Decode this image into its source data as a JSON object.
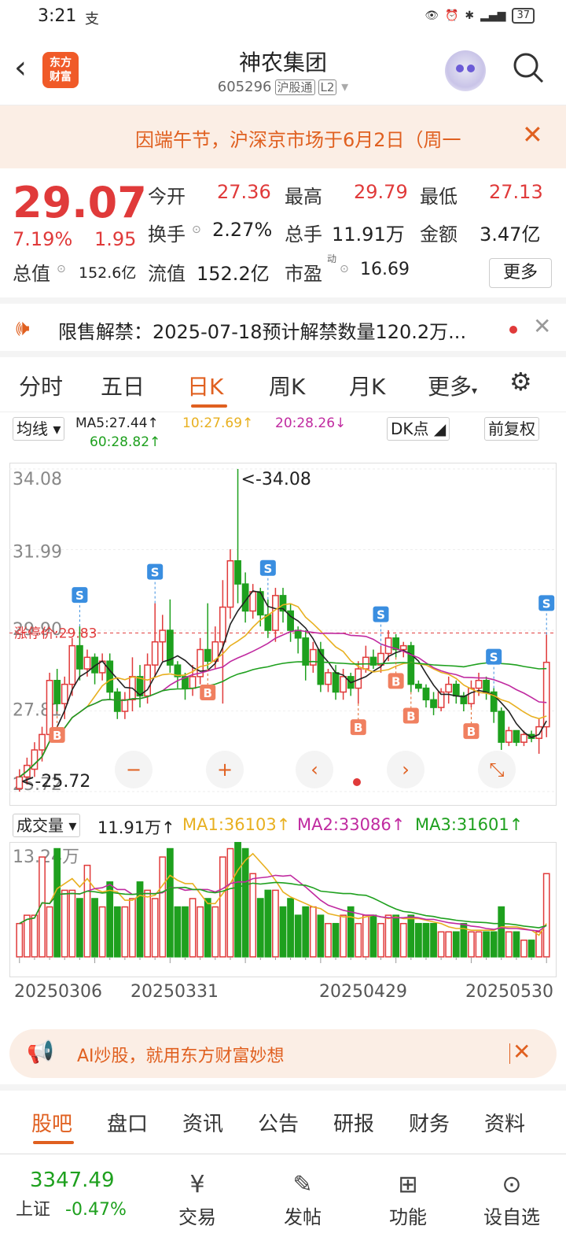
{
  "status": {
    "time": "3:21",
    "alipay": "支",
    "battery": "37"
  },
  "header": {
    "title": "神农集团",
    "code": "605296",
    "tag_market": "沪股通",
    "tag_level": "L2",
    "logo_line1": "东方",
    "logo_line2": "财富"
  },
  "notice": {
    "text": "因端午节，沪深京市场于6月2日（周一"
  },
  "quote": {
    "price": "29.07",
    "change_pct": "7.19%",
    "change": "1.95",
    "open_label": "今开",
    "open": "27.36",
    "high_label": "最高",
    "high": "29.79",
    "low_label": "最低",
    "low": "27.13",
    "turnover_label": "换手",
    "turnover": "2.27%",
    "volume_label": "总手",
    "volume": "11.91万",
    "amount_label": "金额",
    "amount": "3.47亿",
    "mktcap_label": "总值",
    "mktcap": "152.6亿",
    "float_label": "流值",
    "float": "152.2亿",
    "pe_label": "市盈",
    "pe_sup": "动",
    "pe": "16.69",
    "more": "更多"
  },
  "unlock": {
    "text": "限售解禁：2025-07-18预计解禁数量120.2万..."
  },
  "tabs": [
    "分时",
    "五日",
    "日K",
    "周K",
    "月K",
    "更多"
  ],
  "chart_bar": {
    "ma_select": "均线",
    "ma5": "MA5:27.44↑",
    "ma10": "10:27.69↑",
    "ma20": "20:28.26↓",
    "ma60": "60:28.82↑",
    "dk": "DK点",
    "fq": "前复权"
  },
  "kline_labels": {
    "y1": "34.08",
    "y2": "31.99",
    "y3": "29.90",
    "y4": "27.81",
    "y5": "25.72",
    "max_note": "<-34.08",
    "min_note": "<-25.72",
    "limit_note": "涨停价:29.83"
  },
  "volume_bar": {
    "select": "成交量",
    "vol": "11.91万↑",
    "ma1": "MA1:36103↑",
    "ma2": "MA2:33086↑",
    "ma3": "MA3:31601↑",
    "ymax": "13.24万"
  },
  "dates": [
    "20250306",
    "20250331",
    "20250429",
    "20250530"
  ],
  "ai": {
    "text": "AI炒股，就用东方财富妙想"
  },
  "subtabs": [
    "股吧",
    "盘口",
    "资讯",
    "公告",
    "研报",
    "财务",
    "资料"
  ],
  "bottom": {
    "index_value": "3347.49",
    "index_name": "上证",
    "index_change": "-0.47%",
    "items": [
      "交易",
      "发帖",
      "功能",
      "设自选"
    ]
  },
  "colors": {
    "up": "#e03a3a",
    "down": "#1ea01e",
    "accent": "#e06020"
  },
  "chart_data": {
    "type": "candlestick",
    "ylim": [
      25.72,
      34.08
    ],
    "candles": [
      [
        25.8,
        26.1,
        25.72,
        26.3
      ],
      [
        26.1,
        26.4,
        25.9,
        26.6
      ],
      [
        26.3,
        26.8,
        26.1,
        27.0
      ],
      [
        26.8,
        27.2,
        26.5,
        27.4
      ],
      [
        27.2,
        28.6,
        27.0,
        28.8
      ],
      [
        28.6,
        28.0,
        27.8,
        28.9
      ],
      [
        28.0,
        28.5,
        27.6,
        28.7
      ],
      [
        28.5,
        29.5,
        28.2,
        29.7
      ],
      [
        29.5,
        28.9,
        28.6,
        30.0
      ],
      [
        28.9,
        29.2,
        28.7,
        29.4
      ],
      [
        29.2,
        28.8,
        28.5,
        29.3
      ],
      [
        28.8,
        29.1,
        28.6,
        29.3
      ],
      [
        29.1,
        28.3,
        28.1,
        29.3
      ],
      [
        28.3,
        27.8,
        27.6,
        28.4
      ],
      [
        27.8,
        28.1,
        27.6,
        28.3
      ],
      [
        28.1,
        28.7,
        27.8,
        29.2
      ],
      [
        28.7,
        28.2,
        27.9,
        29.0
      ],
      [
        28.2,
        29.0,
        28.0,
        29.3
      ],
      [
        29.0,
        29.6,
        28.7,
        30.6
      ],
      [
        29.6,
        29.9,
        29.1,
        30.3
      ],
      [
        29.9,
        29.0,
        28.8,
        30.7
      ],
      [
        29.0,
        28.7,
        28.4,
        29.1
      ],
      [
        28.7,
        28.4,
        28.1,
        28.8
      ],
      [
        28.4,
        28.7,
        28.2,
        29.0
      ],
      [
        28.7,
        29.4,
        28.5,
        29.7
      ],
      [
        29.4,
        29.1,
        28.9,
        30.6
      ],
      [
        29.1,
        29.6,
        28.9,
        30.0
      ],
      [
        29.6,
        30.5,
        28.0,
        31.2
      ],
      [
        30.5,
        31.7,
        30.2,
        32.0
      ],
      [
        31.7,
        31.1,
        30.6,
        34.08
      ],
      [
        31.1,
        30.4,
        30.1,
        31.4
      ],
      [
        30.4,
        30.9,
        30.2,
        31.1
      ],
      [
        30.9,
        30.3,
        30.0,
        31.0
      ],
      [
        30.3,
        29.9,
        29.7,
        30.7
      ],
      [
        29.9,
        30.8,
        29.6,
        31.0
      ],
      [
        30.8,
        30.4,
        30.1,
        31.0
      ],
      [
        30.4,
        29.9,
        29.6,
        30.6
      ],
      [
        29.9,
        29.7,
        29.3,
        30.0
      ],
      [
        29.7,
        29.0,
        28.6,
        29.9
      ],
      [
        29.0,
        29.4,
        28.8,
        29.6
      ],
      [
        29.4,
        28.5,
        28.3,
        29.6
      ],
      [
        28.5,
        28.8,
        28.3,
        28.9
      ],
      [
        28.8,
        28.3,
        28.1,
        29.0
      ],
      [
        28.3,
        28.7,
        28.1,
        28.9
      ],
      [
        28.7,
        28.4,
        28.2,
        28.8
      ],
      [
        28.4,
        28.9,
        28.0,
        29.1
      ],
      [
        28.9,
        29.2,
        28.8,
        29.5
      ],
      [
        29.2,
        29.0,
        28.9,
        29.4
      ],
      [
        29.0,
        29.3,
        28.8,
        29.5
      ],
      [
        29.3,
        29.7,
        29.1,
        29.9
      ],
      [
        29.7,
        29.4,
        29.2,
        29.8
      ],
      [
        29.4,
        29.5,
        29.2,
        29.6
      ],
      [
        29.5,
        28.5,
        28.3,
        29.6
      ],
      [
        28.5,
        28.4,
        28.3,
        28.6
      ],
      [
        28.4,
        28.1,
        27.9,
        28.5
      ],
      [
        28.1,
        27.9,
        27.7,
        28.3
      ],
      [
        27.9,
        28.3,
        27.8,
        28.4
      ],
      [
        28.3,
        28.5,
        28.0,
        28.7
      ],
      [
        28.5,
        28.2,
        28.0,
        28.6
      ],
      [
        28.2,
        28.0,
        27.8,
        28.3
      ],
      [
        28.0,
        28.4,
        27.9,
        28.6
      ],
      [
        28.4,
        28.6,
        28.2,
        28.8
      ],
      [
        28.6,
        28.3,
        28.1,
        28.7
      ],
      [
        28.3,
        27.8,
        27.5,
        28.4
      ],
      [
        27.8,
        27.0,
        26.8,
        27.9
      ],
      [
        27.0,
        27.3,
        26.9,
        27.4
      ],
      [
        27.3,
        27.0,
        26.9,
        27.2
      ],
      [
        27.0,
        27.2,
        26.9,
        27.3
      ],
      [
        27.2,
        27.1,
        27.0,
        27.3
      ],
      [
        27.1,
        27.4,
        26.7,
        27.6
      ],
      [
        27.4,
        29.07,
        27.13,
        29.79
      ]
    ],
    "volume": [
      4,
      5,
      5,
      12,
      6,
      13,
      8,
      8,
      7,
      11,
      7,
      6,
      9,
      6,
      6,
      7,
      9,
      8,
      7,
      12,
      13,
      6,
      6,
      7,
      6,
      7,
      6,
      12,
      13,
      14,
      13,
      10,
      7,
      8,
      8,
      6,
      7,
      5,
      6,
      6,
      5,
      4,
      4,
      5,
      6,
      4,
      5,
      5,
      4,
      5,
      5,
      4,
      5,
      4,
      4,
      4,
      3,
      3,
      3,
      4,
      3,
      3,
      3,
      3,
      6,
      3,
      3,
      2,
      2,
      3,
      10
    ],
    "volume_ymax": 132400
  }
}
